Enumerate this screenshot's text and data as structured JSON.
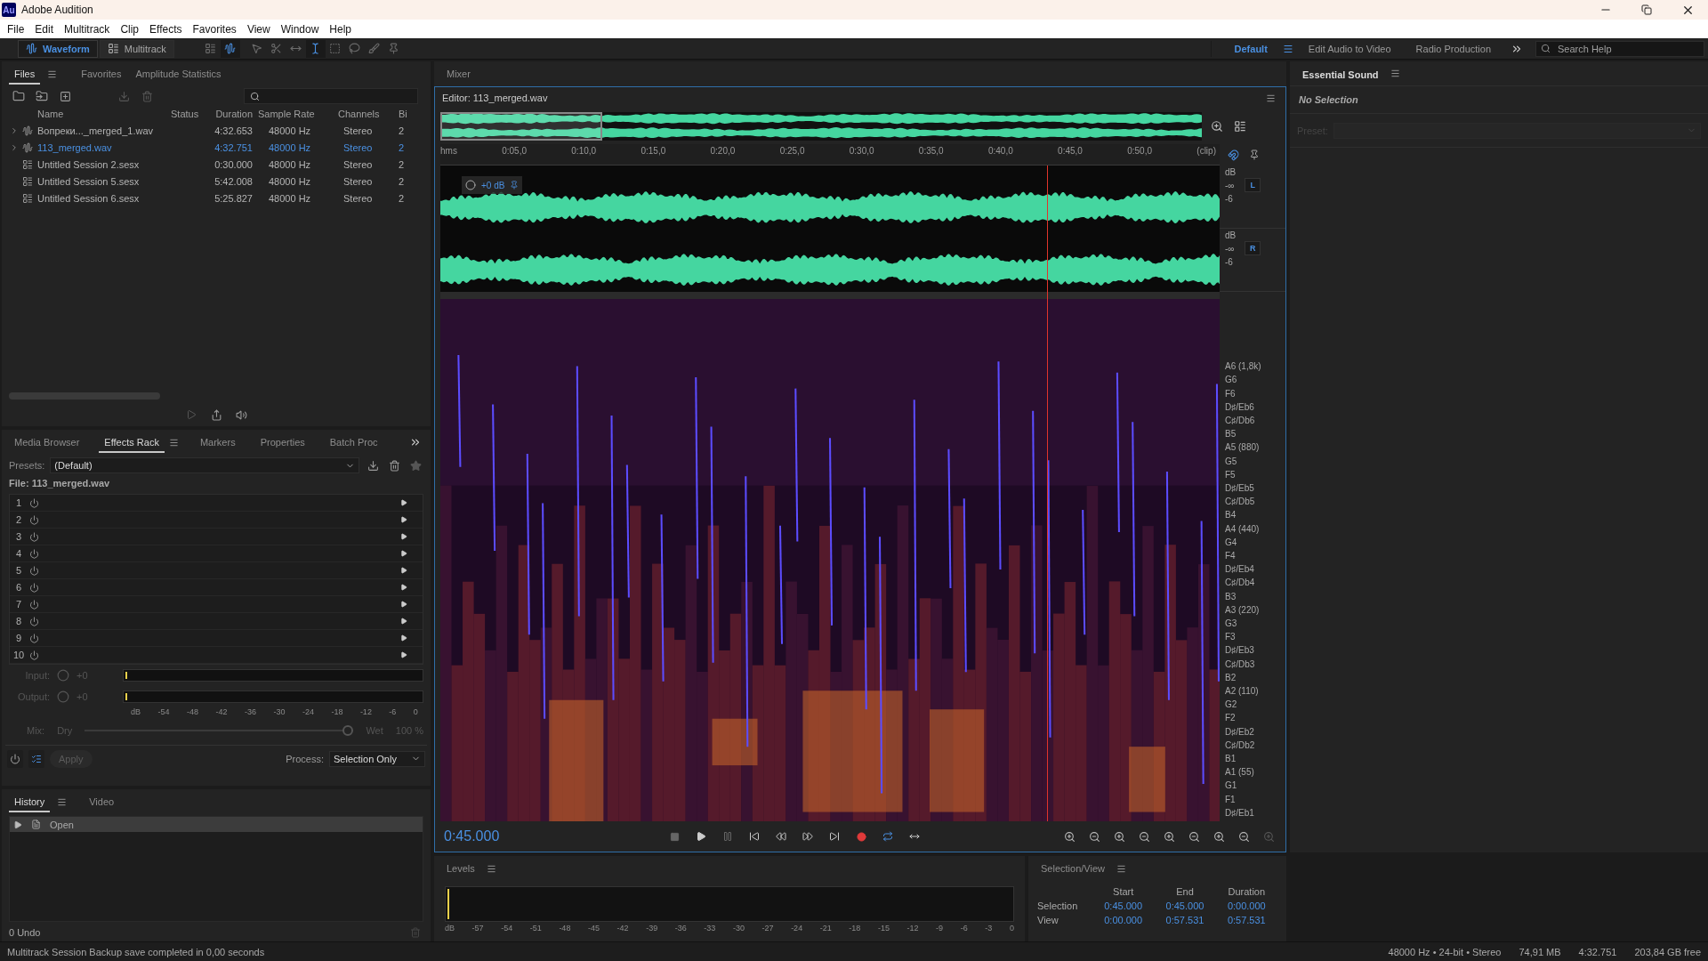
{
  "app": {
    "logo": "Au",
    "title": "Adobe Audition"
  },
  "menu": [
    "File",
    "Edit",
    "Multitrack",
    "Clip",
    "Effects",
    "Favorites",
    "View",
    "Window",
    "Help"
  ],
  "modes": [
    {
      "label": "Waveform",
      "selected": true
    },
    {
      "label": "Multitrack",
      "selected": false
    }
  ],
  "workspaces": [
    {
      "label": "Default",
      "selected": true
    },
    {
      "label": "Edit Audio to Video",
      "selected": false
    },
    {
      "label": "Radio Production",
      "selected": false
    }
  ],
  "search_help": {
    "placeholder": "Search Help"
  },
  "files_panel": {
    "tabs": [
      {
        "label": "Files",
        "selected": true
      },
      {
        "label": "Favorites",
        "selected": false
      },
      {
        "label": "Amplitude Statistics",
        "selected": false
      }
    ],
    "columns": [
      "Name",
      "Status",
      "Duration",
      "Sample Rate",
      "Channels",
      "Bi"
    ],
    "rows": [
      {
        "kind": "audio",
        "name": "Вопреки..._merged_1.wav",
        "duration": "4:32.653",
        "sample_rate": "48000 Hz",
        "channels": "Stereo",
        "bits": "2",
        "selected": false
      },
      {
        "kind": "audio",
        "name": "113_merged.wav",
        "duration": "4:32.751",
        "sample_rate": "48000 Hz",
        "channels": "Stereo",
        "bits": "2",
        "selected": true
      },
      {
        "kind": "session",
        "name": "Untitled Session 2.sesx",
        "duration": "0:30.000",
        "sample_rate": "48000 Hz",
        "channels": "Stereo",
        "bits": "2",
        "selected": false
      },
      {
        "kind": "session",
        "name": "Untitled Session 5.sesx",
        "duration": "5:42.008",
        "sample_rate": "48000 Hz",
        "channels": "Stereo",
        "bits": "2",
        "selected": false
      },
      {
        "kind": "session",
        "name": "Untitled Session 6.sesx",
        "duration": "5:25.827",
        "sample_rate": "48000 Hz",
        "channels": "Stereo",
        "bits": "2",
        "selected": false
      }
    ]
  },
  "effects_panel": {
    "tabs": [
      {
        "label": "Media Browser",
        "selected": false
      },
      {
        "label": "Effects Rack",
        "selected": true
      },
      {
        "label": "Markers",
        "selected": false
      },
      {
        "label": "Properties",
        "selected": false
      },
      {
        "label": "Batch Proc",
        "selected": false
      }
    ],
    "presets_label": "Presets:",
    "preset": "(Default)",
    "file": "File: 113_merged.wav",
    "slots": [
      "1",
      "2",
      "3",
      "4",
      "5",
      "6",
      "7",
      "8",
      "9",
      "10"
    ],
    "input": {
      "label": "Input:",
      "value": "+0"
    },
    "output": {
      "label": "Output:",
      "value": "+0"
    },
    "scale": [
      "dB",
      "-54",
      "-48",
      "-42",
      "-36",
      "-30",
      "-24",
      "-18",
      "-12",
      "-6",
      "0"
    ],
    "mix": {
      "label": "Mix:",
      "dry": "Dry",
      "wet": "Wet",
      "percent": "100 %",
      "level": 1
    },
    "apply": "Apply",
    "process_label": "Process:",
    "process": "Selection Only"
  },
  "history_panel": {
    "tabs": [
      {
        "label": "History",
        "selected": true
      },
      {
        "label": "Video",
        "selected": false
      }
    ],
    "items": [
      {
        "label": "Open",
        "selected": true
      }
    ],
    "undo": "0 Undo"
  },
  "mixer_tab": "Mixer",
  "editor": {
    "title": "Editor: 113_merged.wav",
    "ruler": [
      "hms",
      "0:05,0",
      "0:10,0",
      "0:15,0",
      "0:20,0",
      "0:25,0",
      "0:30,0",
      "0:35,0",
      "0:40,0",
      "0:45,0",
      "0:50,0",
      "(clip)"
    ],
    "gain": "+0 dB",
    "playhead": {
      "level": 0.779
    },
    "channels": [
      {
        "label": "L",
        "scale": [
          "dB",
          "-∞",
          "-6"
        ]
      },
      {
        "label": "R",
        "scale": [
          "dB",
          "-∞",
          "-6"
        ]
      }
    ],
    "notes": [
      "A6 (1,8k)",
      "G6",
      "F6",
      "D♯/Eb6",
      "C♯/Db6",
      "B5",
      "A5 (880)",
      "G5",
      "F5",
      "D♯/Eb5",
      "C♯/Db5",
      "B4",
      "A4 (440)",
      "G4",
      "F4",
      "D♯/Eb4",
      "C♯/Db4",
      "B3",
      "A3 (220)",
      "G3",
      "F3",
      "D♯/Eb3",
      "C♯/Db3",
      "B2",
      "A2 (110)",
      "G2",
      "F2",
      "D♯/Eb2",
      "C♯/Db2",
      "B1",
      "A1 (55)",
      "G1",
      "F1",
      "D♯/Eb1"
    ],
    "time": "0:45.000"
  },
  "levels": {
    "title": "Levels",
    "scale": [
      "dB",
      "-57",
      "-54",
      "-51",
      "-48",
      "-45",
      "-42",
      "-39",
      "-36",
      "-33",
      "-30",
      "-27",
      "-24",
      "-21",
      "-18",
      "-15",
      "-12",
      "-9",
      "-6",
      "-3",
      "0"
    ]
  },
  "selection_view": {
    "title": "Selection/View",
    "columns": [
      "Start",
      "End",
      "Duration"
    ],
    "rows": [
      {
        "label": "Selection",
        "values": [
          "0:45.000",
          "0:45.000",
          "0:00.000"
        ]
      },
      {
        "label": "View",
        "values": [
          "0:00.000",
          "0:57.531",
          "0:57.531"
        ]
      }
    ]
  },
  "essential_sound": {
    "title": "Essential Sound",
    "status": "No Selection",
    "preset_label": "Preset:"
  },
  "status_bar": {
    "message": "Multitrack Session Backup save completed in 0,00 seconds",
    "info": [
      "48000 Hz • 24-bit • Stereo",
      "74,91 MB",
      "4:32.751",
      "203,84 GB free"
    ]
  }
}
